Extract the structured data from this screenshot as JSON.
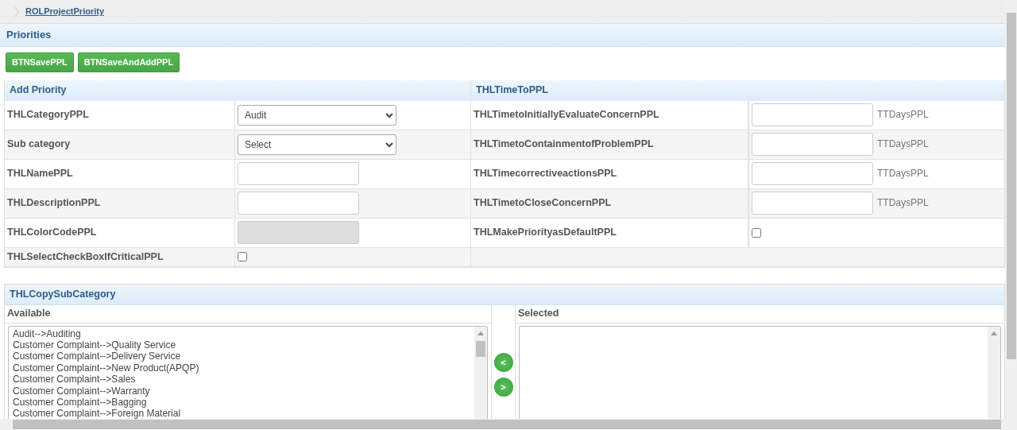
{
  "breadcrumb": "ROLProjectPriority",
  "panel_title": "Priorities",
  "buttons": [
    "BTNSavePPL",
    "BTNSaveAndAddPPL"
  ],
  "add_priority": {
    "title": "Add Priority",
    "rows": [
      {
        "label": "THLCategoryPPL",
        "kind": "select",
        "value": "Audit"
      },
      {
        "label": "Sub category",
        "kind": "select",
        "value": "Select"
      },
      {
        "label": "THLNamePPL",
        "kind": "text",
        "disabled": false
      },
      {
        "label": "THLDescriptionPPL",
        "kind": "text",
        "disabled": false
      },
      {
        "label": "THLColorCodePPL",
        "kind": "text",
        "disabled": true
      },
      {
        "label": "THLSelectCheckBoxIfCriticalPPL",
        "kind": "checkbox",
        "checked": false
      }
    ]
  },
  "time_to": {
    "title": "THLTimeToPPL",
    "rows": [
      {
        "label": "THLTimetoInitiallyEvaluateConcernPPL",
        "kind": "text",
        "unit": "TTDaysPPL"
      },
      {
        "label": "THLTimetoContainmentofProblemPPL",
        "kind": "text",
        "unit": "TTDaysPPL"
      },
      {
        "label": "THLTimecorrectiveactionsPPL",
        "kind": "text",
        "unit": "TTDaysPPL"
      },
      {
        "label": "THLTimetoCloseConcernPPL",
        "kind": "text",
        "unit": "TTDaysPPL"
      },
      {
        "label": "THLMakePriorityasDefaultPPL",
        "kind": "checkbox",
        "checked": false
      }
    ]
  },
  "copy_sub_category": {
    "title": "THLCopySubCategory",
    "available": {
      "label": "Available",
      "items": [
        "Audit-->Auditing",
        "Customer Complaint-->Quality Service",
        "Customer Complaint-->Delivery Service",
        "Customer Complaint-->New Product(APQP)",
        "Customer Complaint-->Sales",
        "Customer Complaint-->Warranty",
        "Customer Complaint-->Bagging",
        "Customer Complaint-->Foreign Material"
      ]
    },
    "move_buttons": [
      "<",
      ">"
    ],
    "selected": {
      "label": "Selected"
    }
  }
}
